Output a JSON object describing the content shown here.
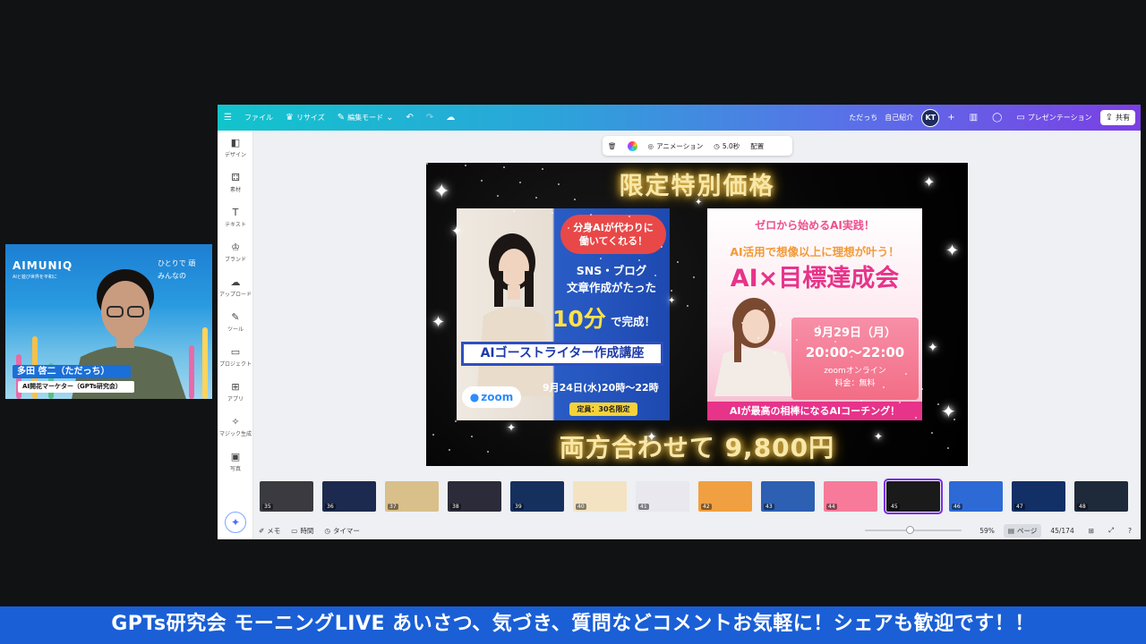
{
  "canva": {
    "topbar": {
      "file": "ファイル",
      "resize": "リサイズ",
      "edit_mode": "編集モード",
      "doc_title": "ただっち　自己紹介",
      "avatar_initials": "KT",
      "present": "プレゼンテーション",
      "share": "共有"
    },
    "sidebar": [
      {
        "icon": "design-icon",
        "glyph": "◧",
        "label": "デザイン"
      },
      {
        "icon": "elements-icon",
        "glyph": "⚃",
        "label": "素材"
      },
      {
        "icon": "text-icon",
        "glyph": "T",
        "label": "テキスト"
      },
      {
        "icon": "brand-icon",
        "glyph": "♔",
        "label": "ブランド"
      },
      {
        "icon": "upload-icon",
        "glyph": "☁",
        "label": "アップロード"
      },
      {
        "icon": "tools-icon",
        "glyph": "✎",
        "label": "ツール"
      },
      {
        "icon": "projects-icon",
        "glyph": "▭",
        "label": "プロジェクト"
      },
      {
        "icon": "apps-icon",
        "glyph": "⊞",
        "label": "アプリ"
      },
      {
        "icon": "magic-media-icon",
        "glyph": "✧",
        "label": "マジック生成"
      },
      {
        "icon": "photos-icon",
        "glyph": "▣",
        "label": "写真"
      }
    ],
    "context_toolbar": {
      "animation": "アニメーション",
      "duration": "5.0秒",
      "position": "配置"
    },
    "slide": {
      "title": "限定特別価格",
      "left": {
        "bubble_line1": "分身AIが代わりに",
        "bubble_line2": "働いてくれる！",
        "line1": "SNS・ブログ",
        "line2": "文章作成がたった",
        "big": "10分",
        "big_suffix": "で完成！",
        "course": "AIゴーストライター作成講座",
        "zoom": "zoom",
        "date": "9月24日(水)20時〜22時",
        "limit": "定員：30名限定"
      },
      "right": {
        "sub": "ゼロから始めるAI実践！",
        "sub2": "AI活用で想像以上に理想が叶う！",
        "title": "AI×目標達成会",
        "date": "9月29日（月）",
        "time": "20:00〜22:00",
        "zoom": "zoomオンライン",
        "fee": "料金：無料",
        "bar": "AIが最高の相棒になるAIコーチング！"
      },
      "bottom": "両方合わせて 9,800円"
    },
    "thumbnails": [
      {
        "num": "35",
        "bg": "#3a3a40"
      },
      {
        "num": "36",
        "bg": "#1b2a4e"
      },
      {
        "num": "37",
        "bg": "#d9c08a"
      },
      {
        "num": "38",
        "bg": "#2b2b3a"
      },
      {
        "num": "39",
        "bg": "#16305e"
      },
      {
        "num": "40",
        "bg": "#f3e3c2"
      },
      {
        "num": "41",
        "bg": "#e8e8ee"
      },
      {
        "num": "42",
        "bg": "#f0a040"
      },
      {
        "num": "43",
        "bg": "#2d5fb3"
      },
      {
        "num": "44",
        "bg": "#f77a9a"
      },
      {
        "num": "45",
        "bg": "#1a1a1a"
      },
      {
        "num": "46",
        "bg": "#2e6ad6"
      },
      {
        "num": "47",
        "bg": "#123066"
      },
      {
        "num": "48",
        "bg": "#1e2a3a"
      }
    ],
    "bottombar": {
      "notes": "メモ",
      "time": "時間",
      "timer": "タイマー",
      "zoom": "59%",
      "pages": "ページ",
      "page_count": "45/174"
    }
  },
  "webcam": {
    "logo": "AIMUNIQ",
    "logo_sub": "AIと遊び世界を平和に",
    "tag_line1": "ひとりで 頑",
    "tag_line2": "みんなの",
    "name": "多田 啓二（ただっち）",
    "role": "AI開花マーケター（GPTs研究会）"
  },
  "ticker": "GPTs研究会 モーニングLIVE あいさつ、気づき、質問などコメントお気軽に！シェアも歓迎です！！"
}
